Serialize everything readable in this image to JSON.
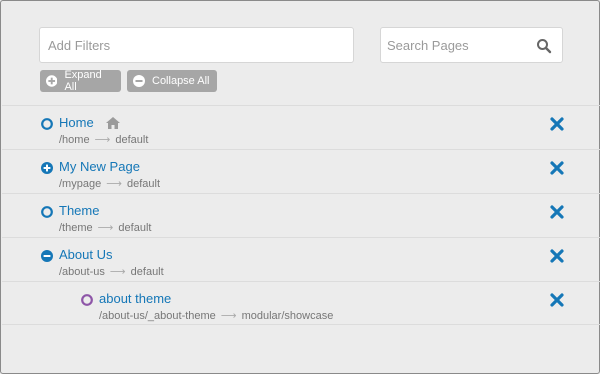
{
  "filters": {
    "placeholder": "Add Filters"
  },
  "search": {
    "placeholder": "Search Pages"
  },
  "buttons": {
    "expand_all": "Expand All",
    "collapse_all": "Collapse All"
  },
  "colors": {
    "link": "#1577b7",
    "button_bg": "#a6a6a6",
    "modular": "#8e56a8"
  },
  "pages": [
    {
      "title": "Home",
      "route": "/home",
      "template": "default",
      "toggle": "open-circle",
      "is_home": true
    },
    {
      "title": "My New Page",
      "route": "/mypage",
      "template": "default",
      "toggle": "plus-circle"
    },
    {
      "title": "Theme",
      "route": "/theme",
      "template": "default",
      "toggle": "open-circle"
    },
    {
      "title": "About Us",
      "route": "/about-us",
      "template": "default",
      "toggle": "minus-circle"
    },
    {
      "title": "about theme",
      "route": "/about-us/_about-theme",
      "template": "modular/showcase",
      "toggle": "open-circle-purple"
    }
  ],
  "arrow_glyph": "⟶"
}
